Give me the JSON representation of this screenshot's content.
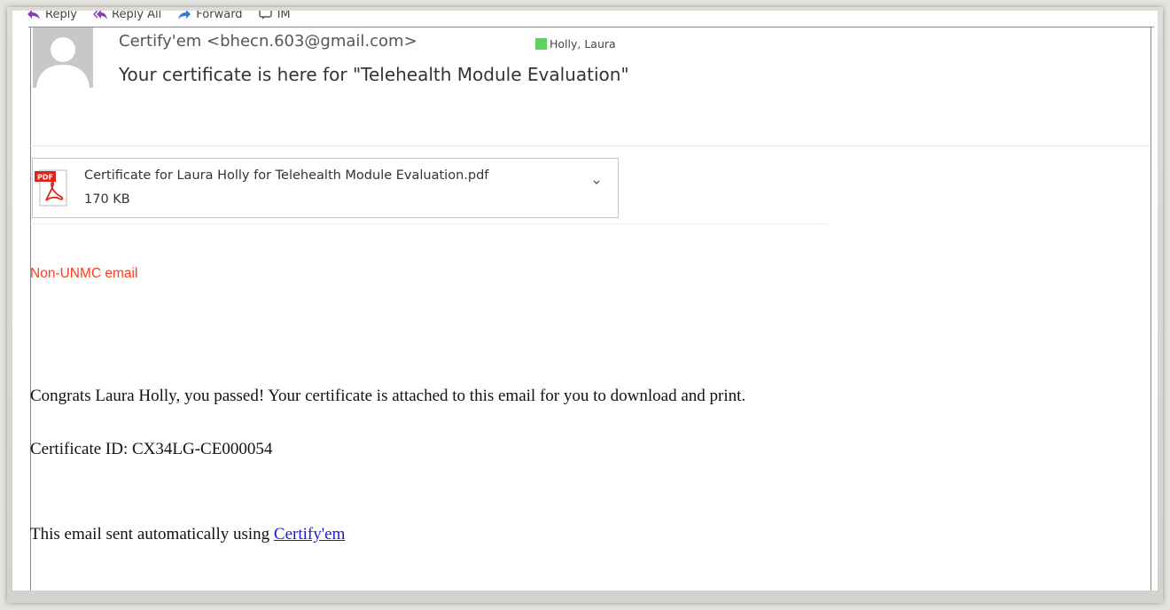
{
  "toolbar": {
    "reply_label": "Reply",
    "reply_all_label": "Reply All",
    "forward_label": "Forward",
    "im_label": "IM"
  },
  "email": {
    "sender": "Certify'em <bhecn.603@gmail.com>",
    "recipient": "Holly, Laura",
    "recipient_status_color": "#5fd35f",
    "subject": "Your certificate is here for \"Telehealth Module Evaluation\""
  },
  "attachment": {
    "icon": "pdf-file-icon",
    "icon_badge": "PDF",
    "filename": "Certificate for Laura Holly for Telehealth Module Evaluation.pdf",
    "size": "170 KB"
  },
  "body": {
    "external_warning": "Non-UNMC email",
    "warning_color": "#ff3a1a",
    "congrats": "Congrats Laura Holly, you passed! Your certificate is attached to this email for you to download and print.",
    "certificate_id": "Certificate ID: CX34LG-CE000054",
    "footer_prefix": "This email sent automatically using ",
    "footer_link": "Certify'em",
    "link_color": "#1a1ad6"
  }
}
